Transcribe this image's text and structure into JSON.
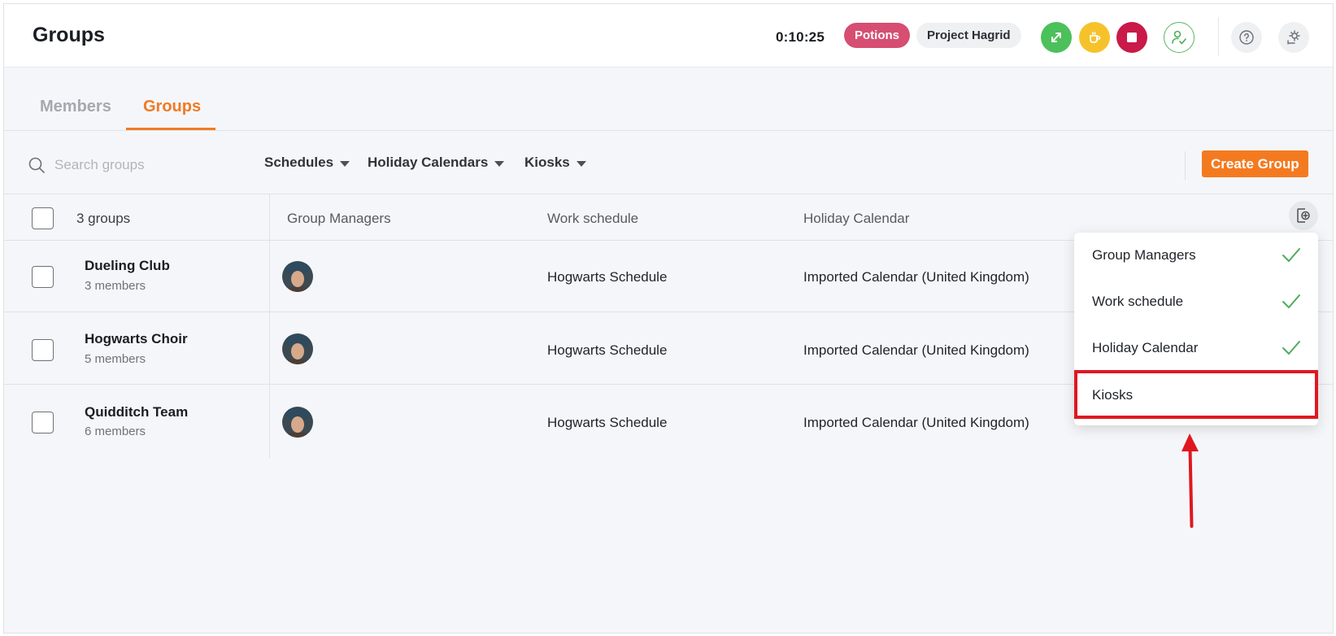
{
  "header": {
    "title": "Groups",
    "timer": "0:10:25",
    "activity_pill": "Potions",
    "project_pill": "Project Hagrid",
    "icons": [
      "swap-icon",
      "coffee-break-icon",
      "stop-icon",
      "user-check-icon",
      "help-icon",
      "settings-icon"
    ],
    "colors": {
      "green": "#4cc05a",
      "yellow": "#f6c22c",
      "red": "#c91a4a",
      "potions": "#d64e72"
    }
  },
  "tabs": [
    {
      "label": "Members",
      "active": false
    },
    {
      "label": "Groups",
      "active": true
    }
  ],
  "filters": {
    "search_placeholder": "Search groups",
    "dropdowns": [
      "Schedules",
      "Holiday Calendars",
      "Kiosks"
    ],
    "create_label": "Create Group"
  },
  "table": {
    "count_label": "3 groups",
    "columns": [
      "Group Managers",
      "Work schedule",
      "Holiday Calendar"
    ],
    "rows": [
      {
        "name": "Dueling Club",
        "members": "3 members",
        "work_schedule": "Hogwarts Schedule",
        "holiday_calendar": "Imported Calendar (United Kingdom)"
      },
      {
        "name": "Hogwarts Choir",
        "members": "5 members",
        "work_schedule": "Hogwarts Schedule",
        "holiday_calendar": "Imported Calendar (United Kingdom)"
      },
      {
        "name": "Quidditch Team",
        "members": "6 members",
        "work_schedule": "Hogwarts Schedule",
        "holiday_calendar": "Imported Calendar (United Kingdom)"
      }
    ]
  },
  "column_menu": {
    "items": [
      {
        "label": "Group Managers",
        "checked": true
      },
      {
        "label": "Work schedule",
        "checked": true
      },
      {
        "label": "Holiday Calendar",
        "checked": true
      },
      {
        "label": "Kiosks",
        "checked": false
      }
    ],
    "highlight_color": "#e0171f"
  },
  "accent_color": "#f07a24"
}
